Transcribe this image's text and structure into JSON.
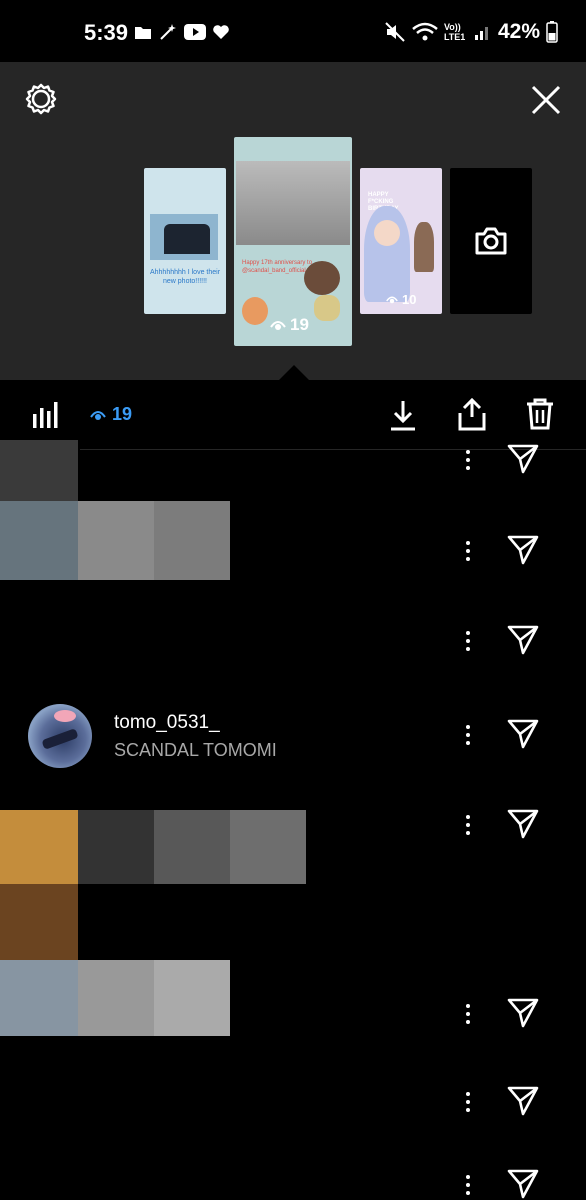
{
  "status_bar": {
    "time": "5:39",
    "left_icons": [
      "folder-icon",
      "magic-wand-icon",
      "youtube-icon",
      "heart-icon"
    ],
    "right_icons": [
      "mute-icon",
      "wifi-icon",
      "volte-icon",
      "signal-icon",
      "battery-icon"
    ],
    "volte_label": "Vo)) LTE1",
    "battery": "42%"
  },
  "story_tray": {
    "thumbnails": [
      {
        "caption": "Ahhhhhhhh I love their new photo!!!!!!"
      },
      {
        "caption": "Happy 17th anniversary to @scandal_band_official",
        "views": "19"
      },
      {
        "caption": "HAPPY F*CKING BIRTHDAY",
        "views": "10"
      },
      {
        "icon": "camera-icon"
      }
    ]
  },
  "toolbar": {
    "views_count": "19",
    "icons": [
      "insights-icon",
      "eye-icon",
      "download-icon",
      "share-icon",
      "delete-icon"
    ]
  },
  "viewers": [
    {
      "username": "tomo_0531_",
      "full_name": "SCANDAL TOMOMI"
    }
  ],
  "colors": {
    "accent": "#3b9cf6",
    "panel": "#262626",
    "background": "#000000",
    "secondary_text": "#a8a8a8"
  }
}
